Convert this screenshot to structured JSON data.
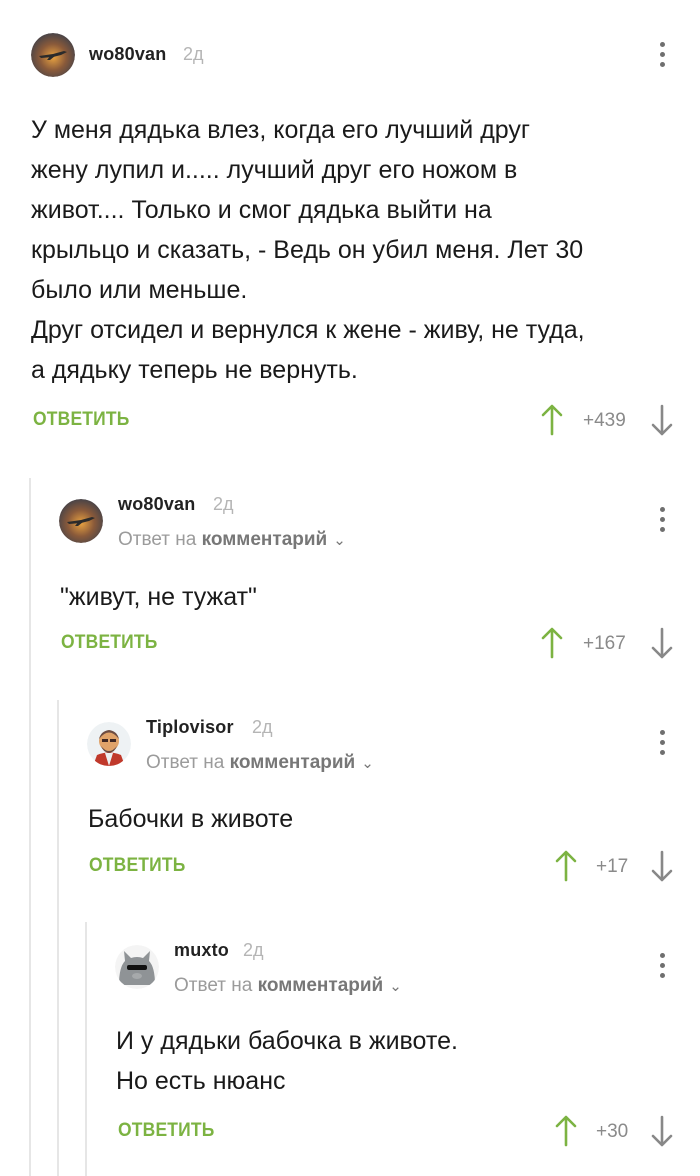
{
  "comments": [
    {
      "author": "wo80van",
      "time": "2д",
      "text_lines": [
        "У меня дядька влез, когда его лучший друг",
        "жену лупил и..... лучший друг его ножом в",
        "живот.... Только и смог дядька выйти на",
        "крыльцо и сказать, - Ведь он убил меня. Лет 30",
        "было или меньше.",
        "Друг отсидел и вернулся к жене - живу, не туда,",
        "а дядьку теперь не вернуть."
      ],
      "reply_label": "ОТВЕТИТЬ",
      "rating": "+439"
    },
    {
      "author": "wo80van",
      "time": "2д",
      "reply_prefix": "Ответ на",
      "reply_target": "комментарий",
      "text_lines": [
        "\"живут, не тужат\""
      ],
      "reply_label": "ОТВЕТИТЬ",
      "rating": "+167"
    },
    {
      "author": "Tiplovisor",
      "time": "2д",
      "reply_prefix": "Ответ на",
      "reply_target": "комментарий",
      "text_lines": [
        "Бабочки в животе"
      ],
      "reply_label": "ОТВЕТИТЬ",
      "rating": "+17"
    },
    {
      "author": "muxto",
      "time": "2д",
      "reply_prefix": "Ответ на",
      "reply_target": "комментарий",
      "text_lines": [
        "И у дядьки бабочка в животе.",
        "Но есть нюанс"
      ],
      "reply_label": "ОТВЕТИТЬ",
      "rating": "+30"
    }
  ],
  "icons": {
    "upvote": "arrow-up-icon",
    "downvote": "arrow-down-icon",
    "more": "more-vertical-icon",
    "expand": "chevron-down-icon"
  },
  "colors": {
    "accent_green": "#7cb342",
    "upvote_green": "#7cb342",
    "muted": "#9b9b9b",
    "thread_line": "#e6e6e6"
  }
}
